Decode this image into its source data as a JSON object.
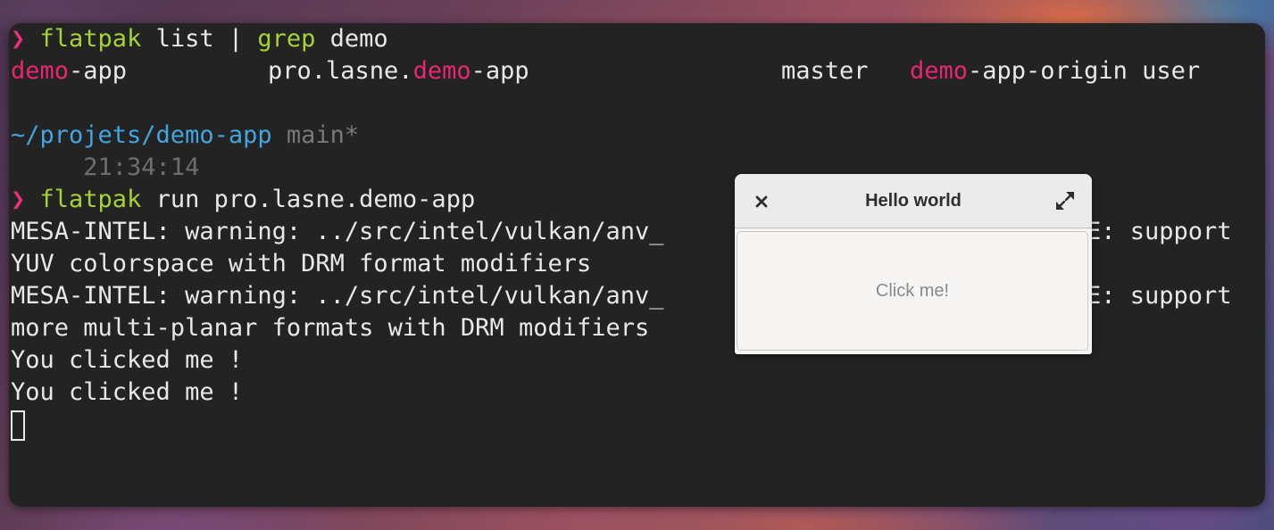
{
  "colors": {
    "terminal_bg": "#232323",
    "text": "#e8e8e8",
    "prompt": "#e5307c",
    "command": "#a6d233",
    "highlight": "#e8276e",
    "directory": "#42a5e0",
    "git_branch": "#787878",
    "dialog_bg": "#f6f5f4"
  },
  "terminal": {
    "prompt_symbol": "❯",
    "cmd1": {
      "program": "flatpak",
      "args": " list | ",
      "grep": "grep",
      "grep_arg": " demo"
    },
    "result_row": {
      "name_hl": "demo",
      "name_rest": "-app",
      "app_id_prefix": "pro.lasne.",
      "app_id_hl": "demo",
      "app_id_rest": "-app",
      "branch": "master",
      "origin_hl": "demo",
      "origin_rest": "-app-origin",
      "installation": "user"
    },
    "cwd": "~/projets/demo-app",
    "git_branch": "main*",
    "time": "21:34:14",
    "cmd2": {
      "program": "flatpak",
      "args": " run pro.lasne.demo-app"
    },
    "output": [
      "MESA-INTEL: warning: ../src/intel/vulkan/anv_",
      "YUV colorspace with DRM format modifiers",
      "MESA-INTEL: warning: ../src/intel/vulkan/anv_",
      "more multi-planar formats with DRM modifiers",
      "You clicked me !",
      "You clicked me !"
    ],
    "output_tail_1": "E: support",
    "output_tail_3": "E: support"
  },
  "dialog": {
    "title": "Hello world",
    "close_icon": "close-icon",
    "maximize_icon": "maximize-icon",
    "button_label": "Click me!"
  }
}
